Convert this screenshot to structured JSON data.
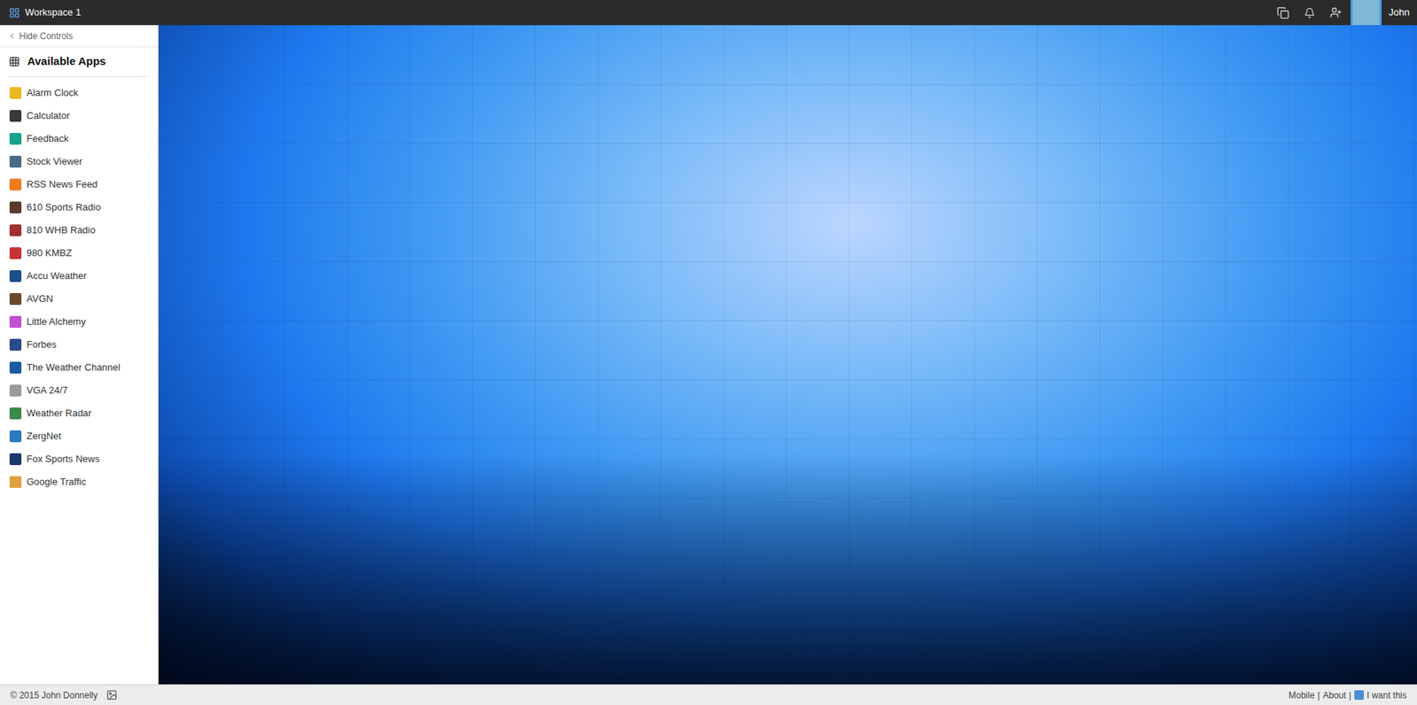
{
  "window": {
    "title": "Workspace 1"
  },
  "user": {
    "name": "John"
  },
  "sidebar": {
    "toggle": "Hide Controls",
    "header": "Available Apps",
    "items": [
      {
        "label": "Alarm Clock",
        "color": "#e8b923"
      },
      {
        "label": "Calculator",
        "color": "#3a3a3a"
      },
      {
        "label": "Feedback",
        "color": "#1aa38a"
      },
      {
        "label": "Stock Viewer",
        "color": "#4a6a8a"
      },
      {
        "label": "RSS News Feed",
        "color": "#f07c1e"
      },
      {
        "label": "610 Sports Radio",
        "color": "#5a3a2a"
      },
      {
        "label": "810 WHB Radio",
        "color": "#a03030"
      },
      {
        "label": "980 KMBZ",
        "color": "#c83232"
      },
      {
        "label": "Accu Weather",
        "color": "#1c4f8a"
      },
      {
        "label": "AVGN",
        "color": "#6a4a2a"
      },
      {
        "label": "Little Alchemy",
        "color": "#c050d0"
      },
      {
        "label": "Forbes",
        "color": "#2a4a8a"
      },
      {
        "label": "The Weather Channel",
        "color": "#1a5aa0"
      },
      {
        "label": "VGA 24/7",
        "color": "#9a9a9a"
      },
      {
        "label": "Weather Radar",
        "color": "#3a8a4a"
      },
      {
        "label": "ZergNet",
        "color": "#2a7ac0"
      },
      {
        "label": "Fox Sports News",
        "color": "#1a3a6a"
      },
      {
        "label": "Google Traffic",
        "color": "#e0a040"
      }
    ]
  },
  "status_bar": {
    "copyright": "© 2015 John Donnelly",
    "separator": "|",
    "links": [
      "Mobile",
      "About",
      "I want this"
    ]
  }
}
